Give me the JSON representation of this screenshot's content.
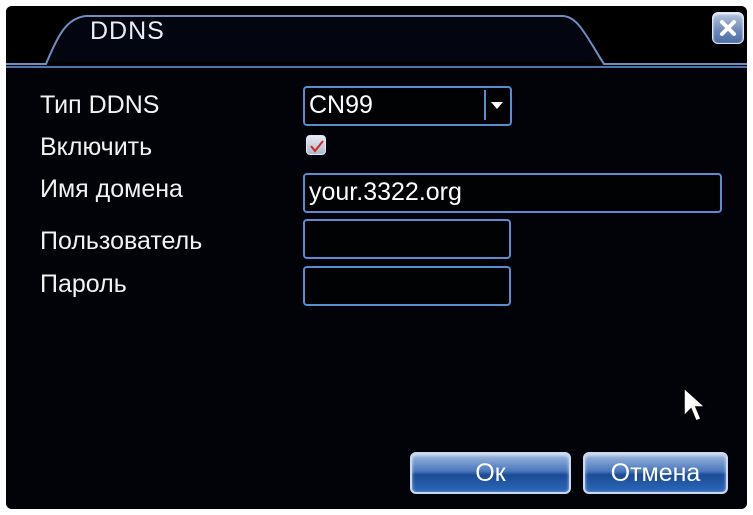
{
  "window": {
    "title": "DDNS",
    "close_icon": "close-icon"
  },
  "form": {
    "ddns_type_label": "Тип DDNS",
    "ddns_type_value": "CN99",
    "enable_label": "Включить",
    "enable_checked": true,
    "domain_label": "Имя домена",
    "domain_value": "your.3322.org",
    "user_label": "Пользователь",
    "user_value": "",
    "password_label": "Пароль",
    "password_value": ""
  },
  "buttons": {
    "ok_label": "Ок",
    "cancel_label": "Отмена"
  },
  "colors": {
    "accent": "#5a8cd0",
    "background": "#02040a",
    "check": "#d2281e"
  }
}
